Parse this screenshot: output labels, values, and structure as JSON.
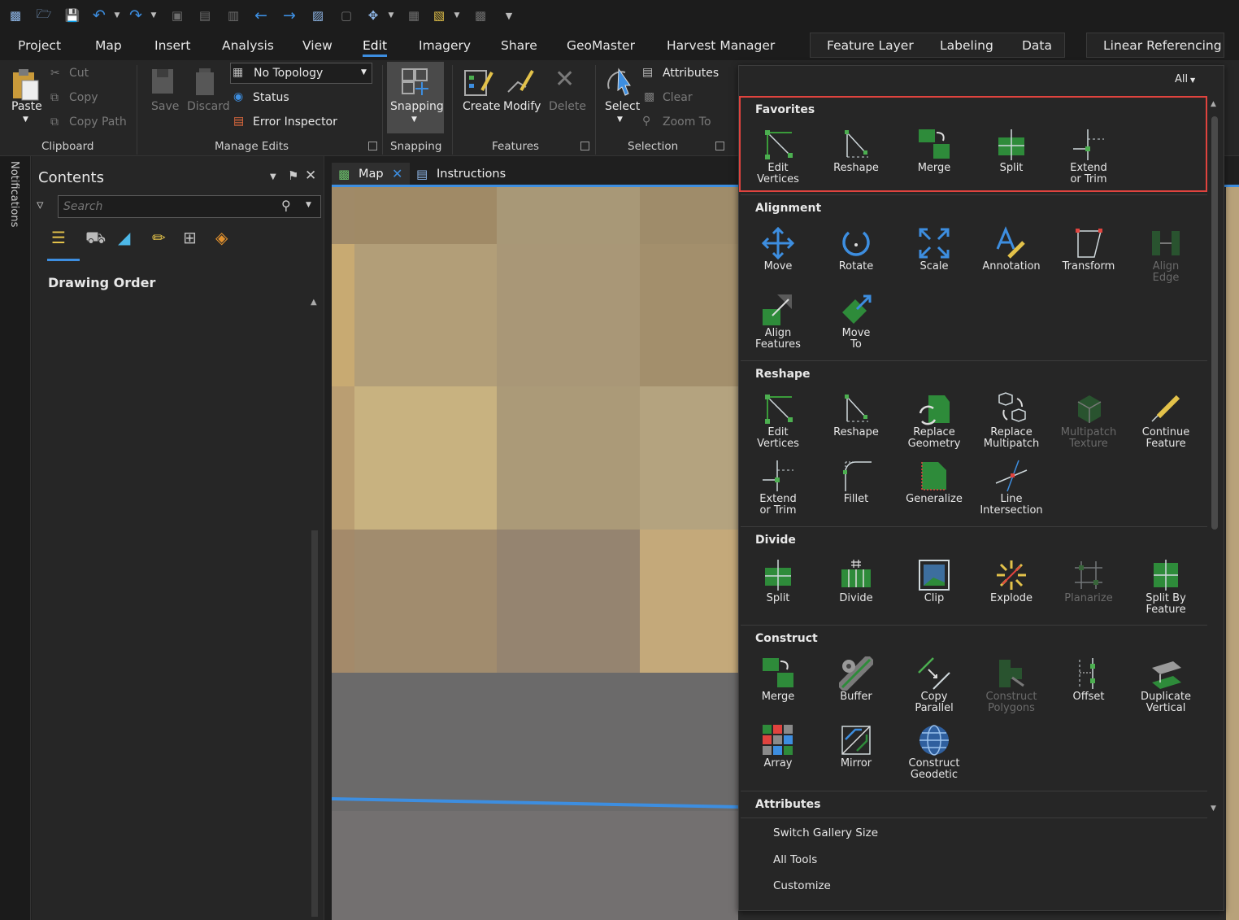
{
  "tabs": {
    "items": [
      "Project",
      "Map",
      "Insert",
      "Analysis",
      "View",
      "Edit",
      "Imagery",
      "Share",
      "GeoMaster",
      "Harvest Manager"
    ],
    "contextual": [
      "Feature Layer",
      "Labeling",
      "Data",
      "Linear Referencing"
    ]
  },
  "ribbon": {
    "clipboard": {
      "paste": "Paste",
      "cut": "Cut",
      "copy": "Copy",
      "copy_path": "Copy Path",
      "label": "Clipboard"
    },
    "manage_edits": {
      "save": "Save",
      "discard": "Discard",
      "topology": "No Topology",
      "status": "Status",
      "error_inspector": "Error Inspector",
      "label": "Manage Edits"
    },
    "snapping": {
      "button": "Snapping",
      "label": "Snapping"
    },
    "features": {
      "create": "Create",
      "modify": "Modify",
      "delete": "Delete",
      "label": "Features"
    },
    "selection": {
      "select": "Select",
      "attributes": "Attributes",
      "clear": "Clear",
      "zoom_to": "Zoom To",
      "label": "Selection"
    }
  },
  "notifications": {
    "label": "Notifications"
  },
  "contents": {
    "title": "Contents",
    "search_placeholder": "Search",
    "drawing_order": "Drawing Order"
  },
  "map_tabs": {
    "map": "Map",
    "instructions": "Instructions"
  },
  "gallery": {
    "filter": "All",
    "favorites": {
      "title": "Favorites",
      "tools": [
        "Edit\nVertices",
        "Reshape",
        "Merge",
        "Split",
        "Extend\nor Trim"
      ]
    },
    "alignment": {
      "title": "Alignment",
      "tools": [
        "Move",
        "Rotate",
        "Scale",
        "Annotation",
        "Transform",
        "Align\nEdge",
        "Align\nFeatures",
        "Move\nTo"
      ]
    },
    "reshape": {
      "title": "Reshape",
      "tools": [
        "Edit\nVertices",
        "Reshape",
        "Replace\nGeometry",
        "Replace\nMultipatch",
        "Multipatch\nTexture",
        "Continue\nFeature",
        "Extend\nor Trim",
        "Fillet",
        "Generalize",
        "Line\nIntersection"
      ]
    },
    "divide": {
      "title": "Divide",
      "tools": [
        "Split",
        "Divide",
        "Clip",
        "Explode",
        "Planarize",
        "Split By\nFeature"
      ]
    },
    "construct": {
      "title": "Construct",
      "tools": [
        "Merge",
        "Buffer",
        "Copy\nParallel",
        "Construct\nPolygons",
        "Offset",
        "Duplicate\nVertical",
        "Array",
        "Mirror",
        "Construct\nGeodetic"
      ]
    },
    "attributes": {
      "title": "Attributes"
    },
    "footer": [
      "Switch Gallery Size",
      "All Tools",
      "Customize"
    ]
  },
  "colors": {
    "accent": "#3d8ee0",
    "highlight": "#e0433e",
    "bg": "#262626"
  }
}
